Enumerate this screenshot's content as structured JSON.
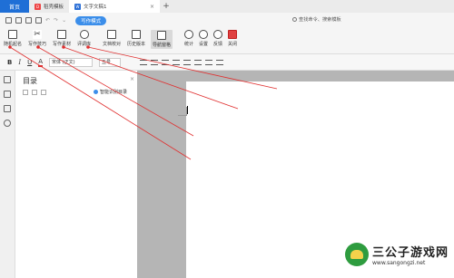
{
  "tabs": {
    "home": "首页",
    "template": "稻壳模板",
    "doc": "文字文稿1",
    "add": "+"
  },
  "quickbar": {
    "write_mode": "写作模式",
    "search_hint": "查找命令、搜索模板"
  },
  "ribbon": {
    "buttons": [
      {
        "label": "随机起名"
      },
      {
        "label": "写作技巧"
      },
      {
        "label": "写作素材"
      },
      {
        "label": "评调库"
      },
      {
        "label": "文档校对"
      },
      {
        "label": "历史版本"
      },
      {
        "label": "导航窗格"
      },
      {
        "label": "统计"
      },
      {
        "label": "设置"
      },
      {
        "label": "反馈"
      },
      {
        "label": "关闭"
      }
    ]
  },
  "format": {
    "bold": "B",
    "italic": "I",
    "underline": "U",
    "font_color": "A",
    "font": "宋体 (正文)",
    "size": "五号"
  },
  "toc": {
    "title": "目录",
    "close": "×",
    "smart": "智能识别目录"
  },
  "watermark": {
    "name": "三公子游戏网",
    "url": "www.sangongzi.net"
  },
  "colors": {
    "accent": "#1f6fd6",
    "annotation": "#e03030"
  }
}
